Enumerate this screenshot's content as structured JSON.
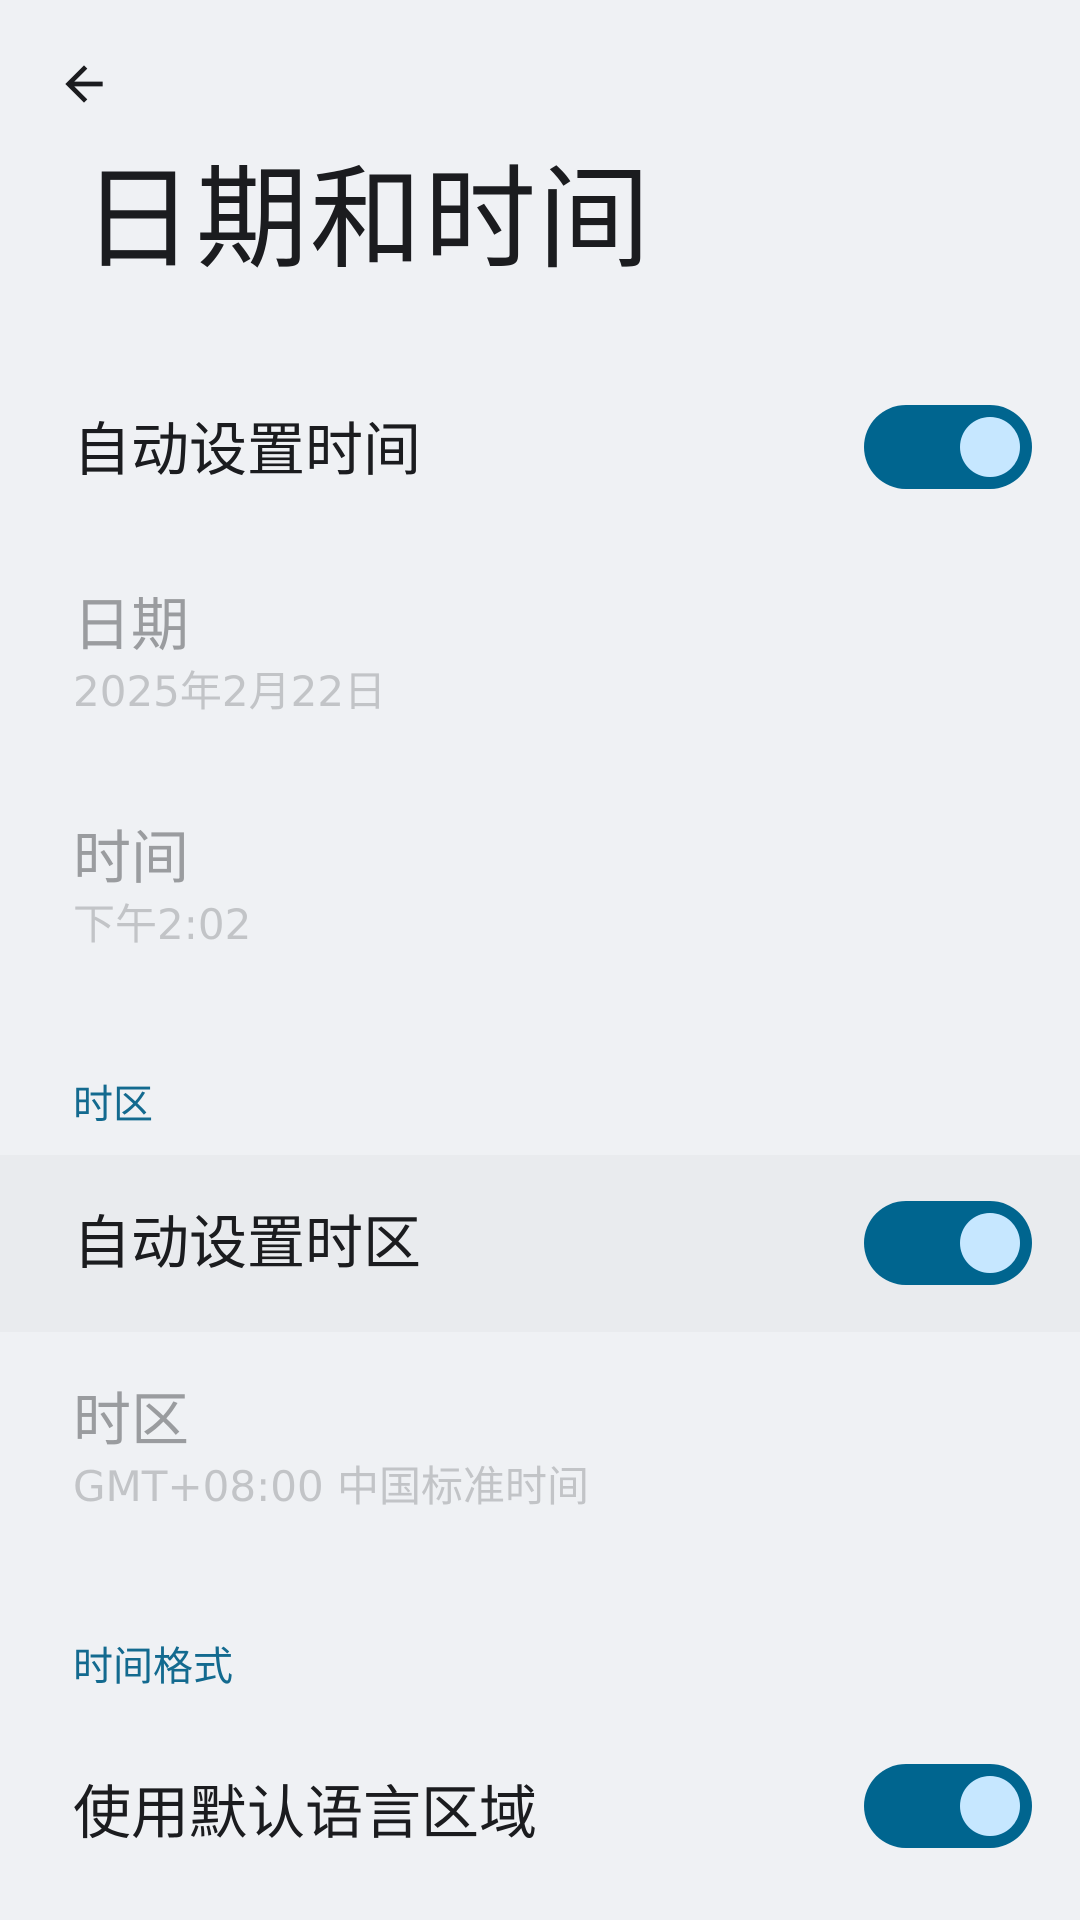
{
  "header": {
    "back_icon": "arrow-back-icon",
    "title": "日期和时间"
  },
  "settings": {
    "auto_time": {
      "title": "自动设置时间",
      "enabled": true
    },
    "date": {
      "title": "日期",
      "summary": "2025年2月22日"
    },
    "time": {
      "title": "时间",
      "summary": "下午2:02"
    },
    "timezone_section": {
      "header": "时区"
    },
    "auto_timezone": {
      "title": "自动设置时区",
      "enabled": true
    },
    "timezone": {
      "title": "时区",
      "summary": "GMT+08:00 中国标准时间"
    },
    "time_format_section": {
      "header": "时间格式"
    },
    "use_locale_default": {
      "title": "使用默认语言区域",
      "enabled": true
    }
  },
  "colors": {
    "background": "#eff1f4",
    "accent": "#00658f",
    "switch_thumb": "#c6e7ff",
    "section_header": "#136a8f",
    "disabled_text": "#9a9c9f",
    "summary_text": "#c2c4c7"
  }
}
